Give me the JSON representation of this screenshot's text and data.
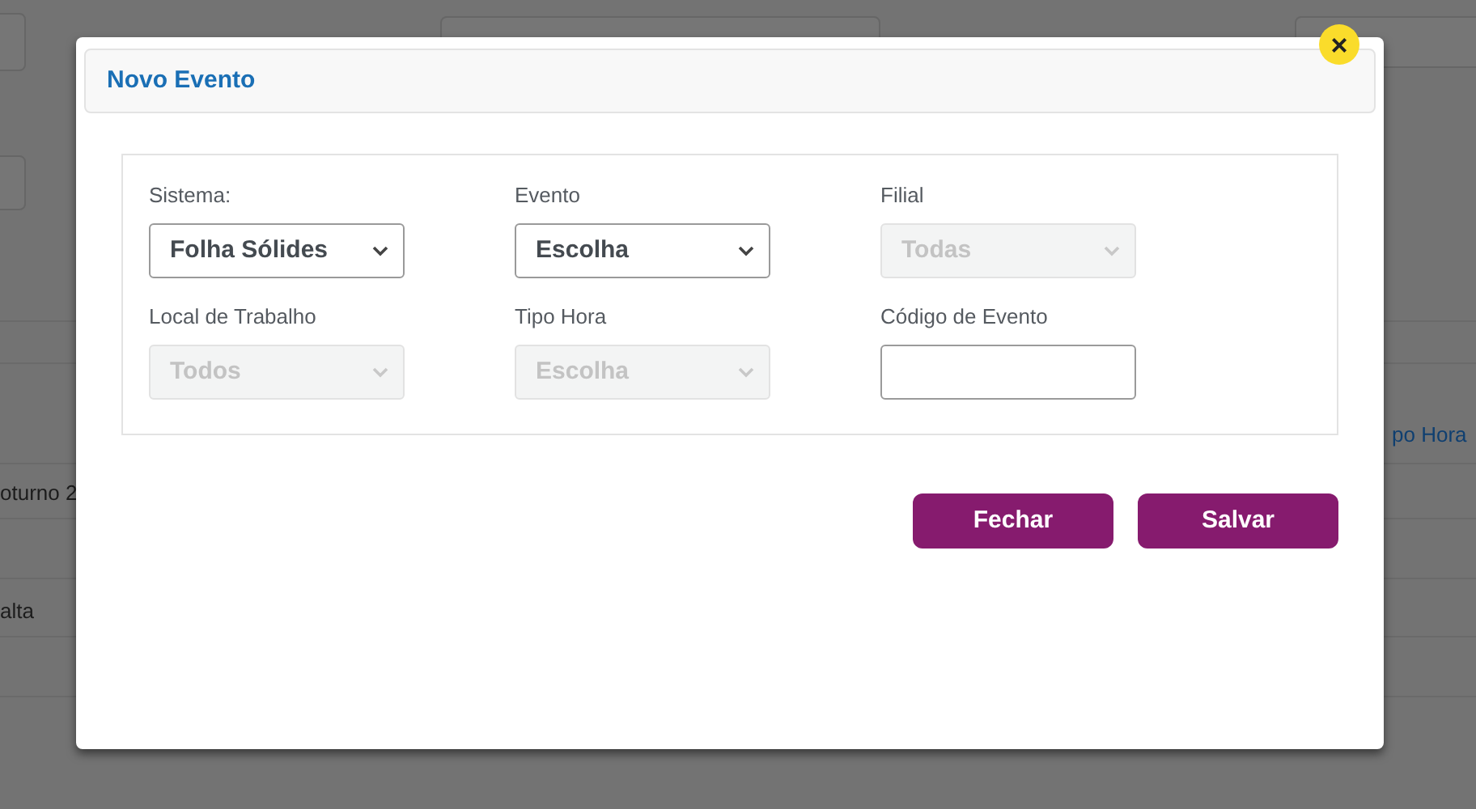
{
  "background": {
    "texts": [
      {
        "text": "oturno 2",
        "kind": "plain"
      },
      {
        "text": "alta",
        "kind": "plain"
      },
      {
        "text": "po Hora",
        "kind": "link"
      }
    ]
  },
  "dialog": {
    "title": "Novo Evento",
    "close": "×",
    "fields": [
      {
        "kind": "select",
        "label": "Sistema:",
        "value": "Folha Sólides",
        "disabled": false
      },
      {
        "kind": "select",
        "label": "Evento",
        "value": "Escolha",
        "disabled": false
      },
      {
        "kind": "select",
        "label": "Filial",
        "value": "Todas",
        "disabled": true
      },
      {
        "kind": "select",
        "label": "Local de Trabalho",
        "value": "Todos",
        "disabled": true
      },
      {
        "kind": "select",
        "label": "Tipo Hora",
        "value": "Escolha",
        "disabled": true
      },
      {
        "kind": "text",
        "label": "Código de Evento",
        "disabled": false
      }
    ],
    "buttons": [
      "Fechar",
      "Salvar"
    ]
  }
}
